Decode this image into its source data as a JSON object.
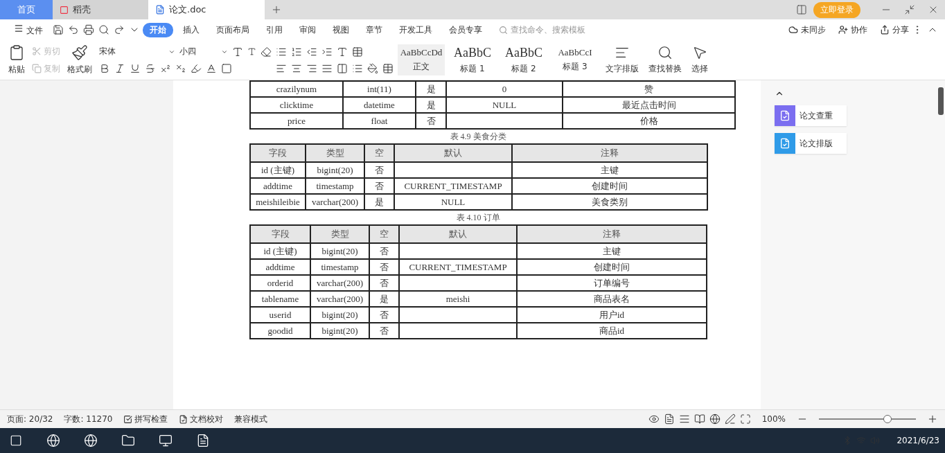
{
  "tabs": [
    {
      "label": "首页",
      "kind": "home",
      "selected": false
    },
    {
      "label": "稻壳",
      "kind": "docer",
      "selected": false
    },
    {
      "label": "论文.doc",
      "kind": "doc",
      "selected": true
    }
  ],
  "account": {
    "label": "立即登录"
  },
  "menu": {
    "file": "文件",
    "items": [
      {
        "label": "开始",
        "selected": true
      },
      {
        "label": "插入",
        "selected": false
      },
      {
        "label": "页面布局",
        "selected": false
      },
      {
        "label": "引用",
        "selected": false
      },
      {
        "label": "审阅",
        "selected": false
      },
      {
        "label": "视图",
        "selected": false
      },
      {
        "label": "章节",
        "selected": false
      },
      {
        "label": "开发工具",
        "selected": false
      },
      {
        "label": "会员专享",
        "selected": false
      }
    ],
    "search": {
      "placeholder": "查找命令、搜索模板"
    },
    "actions": [
      "未同步",
      "协作",
      "分享"
    ]
  },
  "ribbon": {
    "paste": "粘贴",
    "cut": {
      "label": "剪切",
      "disabled": true
    },
    "copy": {
      "label": "复制",
      "disabled": true
    },
    "format_painter": "格式刷",
    "font": "宋体",
    "size": "小四",
    "styles": [
      {
        "sample": "AaBbCcDd",
        "label": "正文",
        "selected": true
      },
      {
        "sample": "AaBbC",
        "label": "标题 1",
        "selected": false
      },
      {
        "sample": "AaBbC",
        "label": "标题 2",
        "selected": false
      },
      {
        "sample": "AaBbCcI",
        "label": "标题 3",
        "selected": false
      }
    ],
    "tools": [
      "文字排版",
      "查找替换",
      "选择"
    ]
  },
  "document": {
    "tables": [
      {
        "rows": [
          [
            "crazilynum",
            "int(11)",
            "是",
            "0",
            "赞"
          ],
          [
            "clicktime",
            "datetime",
            "是",
            "NULL",
            "最近点击时间"
          ],
          [
            "price",
            "float",
            "否",
            "",
            "价格"
          ]
        ]
      },
      {
        "caption": "表 4.9 美食分类",
        "columns": [
          "字段",
          "类型",
          "空",
          "默认",
          "注释"
        ],
        "rows": [
          [
            "id (主键)",
            "bigint(20)",
            "否",
            "",
            "主键"
          ],
          [
            "addtime",
            "timestamp",
            "否",
            "CURRENT_TIMESTAMP",
            "创建时间"
          ],
          [
            "meishileibie",
            "varchar(200)",
            "是",
            "NULL",
            "美食类别"
          ]
        ]
      },
      {
        "caption": "表 4.10 订单",
        "columns": [
          "字段",
          "类型",
          "空",
          "默认",
          "注释"
        ],
        "rows": [
          [
            "id (主键)",
            "bigint(20)",
            "否",
            "",
            "主键"
          ],
          [
            "addtime",
            "timestamp",
            "否",
            "CURRENT_TIMESTAMP",
            "创建时间"
          ],
          [
            "orderid",
            "varchar(200)",
            "否",
            "",
            "订单编号"
          ],
          [
            "tablename",
            "varchar(200)",
            "是",
            "meishi",
            "商品表名"
          ],
          [
            "userid",
            "bigint(20)",
            "否",
            "",
            "用户id"
          ],
          [
            "goodid",
            "bigint(20)",
            "否",
            "",
            "商品id"
          ]
        ]
      }
    ]
  },
  "side_panel": [
    {
      "label": "论文查重",
      "color": "#7b6ef0"
    },
    {
      "label": "论文排版",
      "color": "#2f9be8"
    }
  ],
  "status_bar": {
    "page": "页面: 20/32",
    "words": "字数: 11270",
    "spell": "拼写检查",
    "proof": "文档校对",
    "mode": "兼容模式",
    "zoom": "100%",
    "zoom_level": {
      "level": 0.73
    }
  },
  "taskbar": {
    "date": "2021/6/23"
  }
}
